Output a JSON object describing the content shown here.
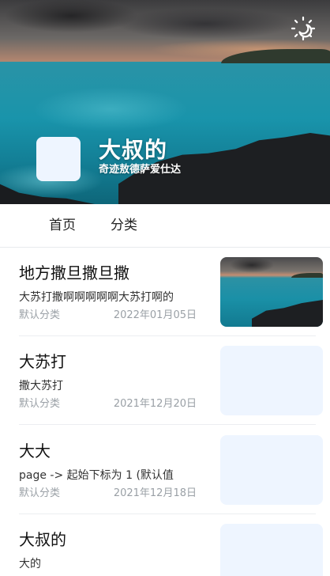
{
  "header": {
    "site_title": "大叔的",
    "site_subtitle": "奇迹敖德萨爱仕达",
    "theme_toggle_icon": "sun-moon-icon"
  },
  "nav": {
    "tabs": [
      {
        "label": "首页"
      },
      {
        "label": "分类"
      }
    ]
  },
  "posts": [
    {
      "title": "地方撒旦撒旦撒",
      "excerpt": "大苏打撒啊啊啊啊啊大苏打啊的",
      "category": "默认分类",
      "date": "2022年01月05日",
      "thumbnail": "seascape-image"
    },
    {
      "title": "大苏打",
      "excerpt": "撒大苏打",
      "category": "默认分类",
      "date": "2021年12月20日",
      "thumbnail": "placeholder"
    },
    {
      "title": "大大",
      "excerpt": "page -> 起始下标为 1 (默认值",
      "category": "默认分类",
      "date": "2021年12月18日",
      "thumbnail": "placeholder"
    },
    {
      "title": "大叔的",
      "excerpt": "大的",
      "category": "",
      "date": "",
      "thumbnail": "placeholder"
    }
  ],
  "colors": {
    "accent_placeholder": "#eef5ff",
    "meta_text": "#9aa0a6",
    "divider": "#eceef1"
  }
}
